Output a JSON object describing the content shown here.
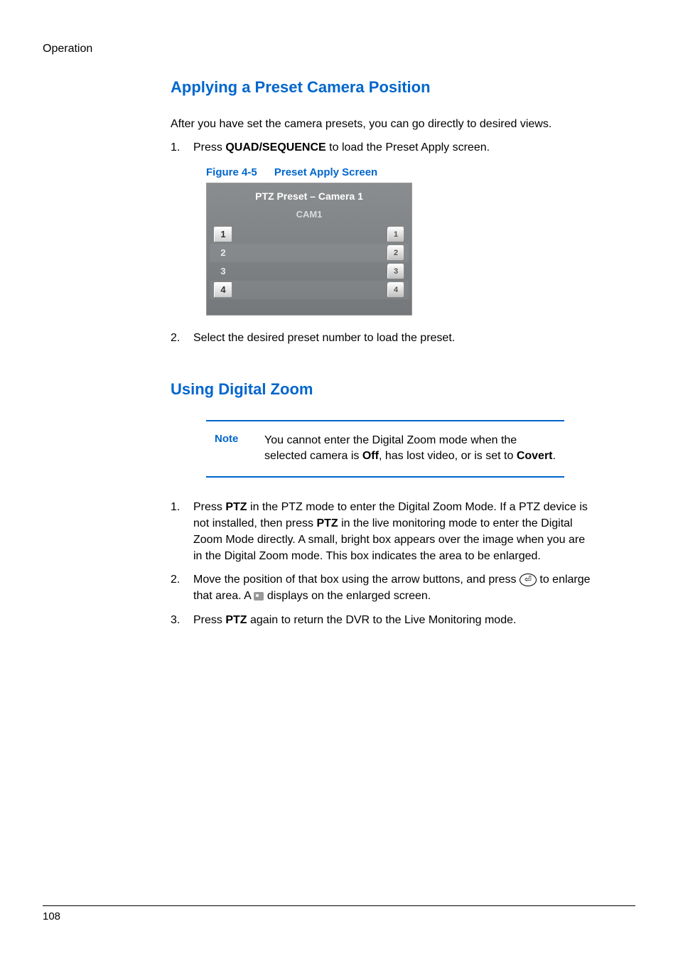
{
  "header": {
    "section_label": "Operation"
  },
  "section1": {
    "heading": "Applying a Preset Camera Position",
    "intro": "After you have set the camera presets, you can go directly to desired views.",
    "steps": [
      {
        "num": "1.",
        "pre": "Press ",
        "b1": "QUAD/SEQUENCE",
        "post": " to load the Preset Apply screen."
      },
      {
        "num": "2.",
        "pre": "Select the desired preset number to load the preset."
      }
    ],
    "figure": {
      "label": "Figure 4-5",
      "title": "Preset Apply Screen",
      "panel_title": "PTZ Preset – Camera 1",
      "panel_subtitle": "CAM1",
      "rows": [
        {
          "left": "1",
          "light": true,
          "right": "1"
        },
        {
          "left": "2",
          "light": false,
          "right": "2"
        },
        {
          "left": "3",
          "light": false,
          "right": "3"
        },
        {
          "left": "4",
          "light": true,
          "right": "4"
        }
      ]
    }
  },
  "section2": {
    "heading": "Using Digital Zoom",
    "note_label": "Note",
    "note_text_pre": "You cannot enter the Digital Zoom mode when the selected camera is ",
    "note_b1": "Off",
    "note_mid": ", has lost video, or is set to ",
    "note_b2": "Covert",
    "note_end": ".",
    "steps": {
      "s1": {
        "num": "1.",
        "pre": "Press ",
        "b1": "PTZ",
        "mid1": " in the PTZ mode to enter the Digital Zoom Mode. If a PTZ device is not installed, then press ",
        "b2": "PTZ",
        "mid2": " in the live monitoring mode to enter the Digital Zoom Mode directly. A small, bright box appears over the image when you are in the Digital Zoom mode. This box indicates the area to be enlarged."
      },
      "s2": {
        "num": "2.",
        "pre": "Move the position of that box using the arrow buttons, and press ",
        "post_icon": " to enlarge that area. A ",
        "post_end": " displays on the enlarged screen."
      },
      "s3": {
        "num": "3.",
        "pre": "Press ",
        "b1": "PTZ",
        "post": " again to return the DVR to the Live Monitoring mode."
      }
    }
  },
  "footer": {
    "page": "108"
  }
}
